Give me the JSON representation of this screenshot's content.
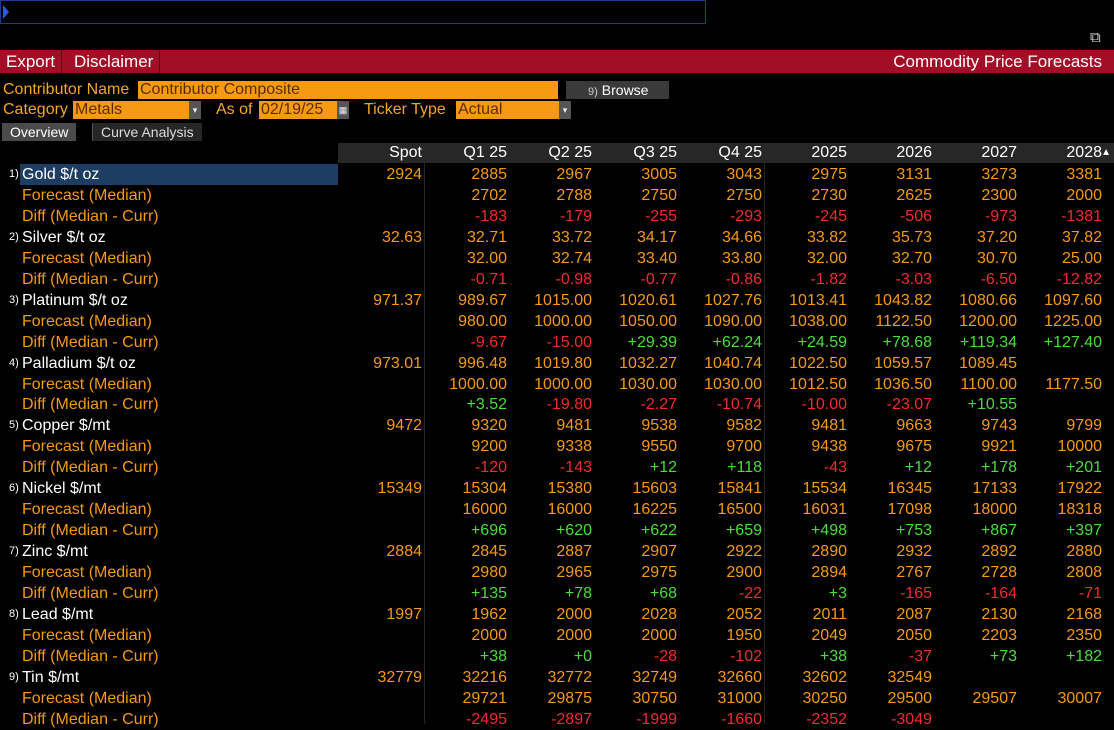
{
  "commodities": [
    {
      "index": "1)",
      "name": "Gold $/t oz",
      "spot": "2924",
      "values": [
        "2885",
        "2967",
        "3005",
        "3043",
        "2975",
        "3131",
        "3273",
        "3381"
      ],
      "forecast": [
        "2702",
        "2788",
        "2750",
        "2750",
        "2730",
        "2625",
        "2300",
        "2000"
      ],
      "diff": [
        "-183",
        "-179",
        "-255",
        "-293",
        "-245",
        "-506",
        "-973",
        "-1381"
      ]
    },
    {
      "index": "2)",
      "name": "Silver $/t oz",
      "spot": "32.63",
      "values": [
        "32.71",
        "33.72",
        "34.17",
        "34.66",
        "33.82",
        "35.73",
        "37.20",
        "37.82"
      ],
      "forecast": [
        "32.00",
        "32.74",
        "33.40",
        "33.80",
        "32.00",
        "32.70",
        "30.70",
        "25.00"
      ],
      "diff": [
        "-0.71",
        "-0.98",
        "-0.77",
        "-0.86",
        "-1.82",
        "-3.03",
        "-6.50",
        "-12.82"
      ]
    },
    {
      "index": "3)",
      "name": "Platinum $/t oz",
      "spot": "971.37",
      "values": [
        "989.67",
        "1015.00",
        "1020.61",
        "1027.76",
        "1013.41",
        "1043.82",
        "1080.66",
        "1097.60"
      ],
      "forecast": [
        "980.00",
        "1000.00",
        "1050.00",
        "1090.00",
        "1038.00",
        "1122.50",
        "1200.00",
        "1225.00"
      ],
      "diff": [
        "-9.67",
        "-15.00",
        "+29.39",
        "+62.24",
        "+24.59",
        "+78.68",
        "+119.34",
        "+127.40"
      ]
    },
    {
      "index": "4)",
      "name": "Palladium $/t oz",
      "spot": "973.01",
      "values": [
        "996.48",
        "1019.80",
        "1032.27",
        "1040.74",
        "1022.50",
        "1059.57",
        "1089.45",
        ""
      ],
      "forecast": [
        "1000.00",
        "1000.00",
        "1030.00",
        "1030.00",
        "1012.50",
        "1036.50",
        "1100.00",
        "1177.50"
      ],
      "diff": [
        "+3.52",
        "-19.80",
        "-2.27",
        "-10.74",
        "-10.00",
        "-23.07",
        "+10.55",
        ""
      ]
    },
    {
      "index": "5)",
      "name": "Copper $/mt",
      "spot": "9472",
      "values": [
        "9320",
        "9481",
        "9538",
        "9582",
        "9481",
        "9663",
        "9743",
        "9799"
      ],
      "forecast": [
        "9200",
        "9338",
        "9550",
        "9700",
        "9438",
        "9675",
        "9921",
        "10000"
      ],
      "diff": [
        "-120",
        "-143",
        "+12",
        "+118",
        "-43",
        "+12",
        "+178",
        "+201"
      ]
    },
    {
      "index": "6)",
      "name": "Nickel $/mt",
      "spot": "15349",
      "values": [
        "15304",
        "15380",
        "15603",
        "15841",
        "15534",
        "16345",
        "17133",
        "17922"
      ],
      "forecast": [
        "16000",
        "16000",
        "16225",
        "16500",
        "16031",
        "17098",
        "18000",
        "18318"
      ],
      "diff": [
        "+696",
        "+620",
        "+622",
        "+659",
        "+498",
        "+753",
        "+867",
        "+397"
      ]
    },
    {
      "index": "7)",
      "name": "Zinc $/mt",
      "spot": "2884",
      "values": [
        "2845",
        "2887",
        "2907",
        "2922",
        "2890",
        "2932",
        "2892",
        "2880"
      ],
      "forecast": [
        "2980",
        "2965",
        "2975",
        "2900",
        "2894",
        "2767",
        "2728",
        "2808"
      ],
      "diff": [
        "+135",
        "+78",
        "+68",
        "-22",
        "+3",
        "-165",
        "-164",
        "-71"
      ]
    },
    {
      "index": "8)",
      "name": "Lead $/mt",
      "spot": "1997",
      "values": [
        "1962",
        "2000",
        "2028",
        "2052",
        "2011",
        "2087",
        "2130",
        "2168"
      ],
      "forecast": [
        "2000",
        "2000",
        "2000",
        "1950",
        "2049",
        "2050",
        "2203",
        "2350"
      ],
      "diff": [
        "+38",
        "+0",
        "-28",
        "-102",
        "+38",
        "-37",
        "+73",
        "+182"
      ]
    },
    {
      "index": "9)",
      "name": "Tin $/mt",
      "spot": "32779",
      "values": [
        "32216",
        "32772",
        "32749",
        "32660",
        "32602",
        "32549",
        "",
        ""
      ],
      "forecast": [
        "29721",
        "29875",
        "30750",
        "31000",
        "30250",
        "29500",
        "29507",
        "30007"
      ],
      "diff": [
        "-2495",
        "-2897",
        "-1999",
        "-1660",
        "-2352",
        "-3049",
        "",
        ""
      ]
    }
  ],
  "forecast_label": "Forecast (Median)",
  "diff_label": "Diff (Median - Curr)",
  "menu": {
    "export": "Export",
    "disclaimer": "Disclaimer"
  },
  "app_title": "Commodity Price Forecasts",
  "contributor": {
    "label": "Contributor Name",
    "value": "Contributor Composite",
    "browse_num": "9)",
    "browse_label": "Browse"
  },
  "category": {
    "label": "Category",
    "value": "Metals"
  },
  "as_of": {
    "label": "As of",
    "value": "02/19/25"
  },
  "ticker_type": {
    "label": "Ticker Type",
    "value": "Actual"
  },
  "tabs": [
    "Overview",
    "Curve Analysis"
  ],
  "columns": [
    "Spot",
    "Q1 25",
    "Q2 25",
    "Q3 25",
    "Q4 25",
    "2025",
    "2026",
    "2027",
    "2028"
  ],
  "colors": {
    "accent_red": "#a30e27",
    "field_orange": "#f59a12",
    "positive": "#4ade3a",
    "negative": "#f02c2c",
    "selection": "#1d3d62"
  }
}
